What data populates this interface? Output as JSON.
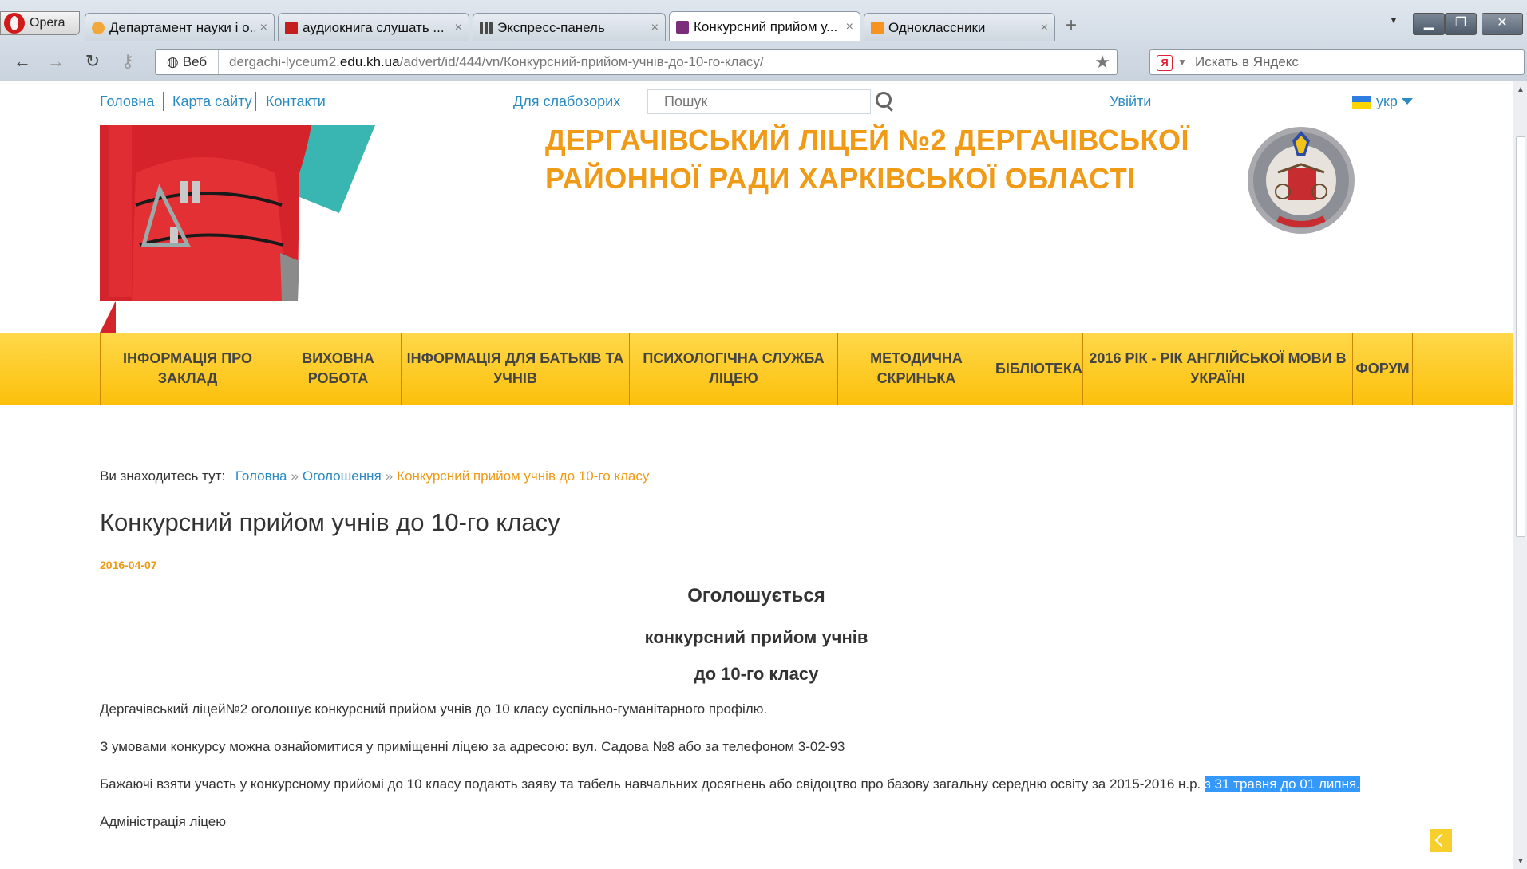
{
  "browser": {
    "opera_label": "Opera",
    "tabs": [
      {
        "title": "Департамент науки і о...",
        "close": "×",
        "icon_color": "#f2a83a"
      },
      {
        "title": "аудиокнига слушать ...",
        "close": "×",
        "icon_color": "#c41e1e"
      },
      {
        "title": "Экспресс-панель",
        "close": "×",
        "icon_color": "#4a4a4a"
      },
      {
        "title": "Конкурсний прийом у...",
        "close": "×",
        "icon_color": "#7a2e7a"
      },
      {
        "title": "Одноклассники",
        "close": "×",
        "icon_color": "#f7931e"
      }
    ],
    "address_mode": "Веб",
    "url_prefix": "dergachi-lyceum2.",
    "url_domain": "edu.kh.ua",
    "url_path": "/advert/id/444/vn/Конкурсний-прийом-учнів-до-10-го-класу/",
    "search_placeholder": "Искать в Яндекс",
    "yandex_letter": "Я"
  },
  "site": {
    "topnav": {
      "home": "Головна",
      "sitemap": "Карта сайту",
      "contacts": "Контакти",
      "low_vision": "Для слабозорих",
      "search_placeholder": "Пошук",
      "login": "Увійти",
      "lang": "укр"
    },
    "title_line1": "ДЕРГАЧІВСЬКИЙ ЛІЦЕЙ №2 ДЕРГАЧІВСЬКОЇ",
    "title_line2": "РАЙОННОЇ РАДИ ХАРКІВСЬКОЇ ОБЛАСТІ",
    "menu": [
      {
        "line1": "ІНФОРМАЦІЯ ПРО",
        "line2": "ЗАКЛАД"
      },
      {
        "line1": "ВИХОВНА",
        "line2": "РОБОТА"
      },
      {
        "line1": "ІНФОРМАЦІЯ ДЛЯ БАТЬКІВ ТА",
        "line2": "УЧНІВ"
      },
      {
        "line1": "ПСИХОЛОГІЧНА СЛУЖБА",
        "line2": "ЛІЦЕЮ"
      },
      {
        "line1": "МЕТОДИЧНА",
        "line2": "СКРИНЬКА"
      },
      {
        "line1": "БІБЛІОТЕКА",
        "line2": ""
      },
      {
        "line1": "2016 РІК - РІК АНГЛІЙСЬКОЇ МОВИ В",
        "line2": "УКРАЇНІ"
      },
      {
        "line1": "ФОРУМ",
        "line2": ""
      }
    ],
    "colors": {
      "accent_orange": "#f09a15",
      "link_blue": "#2c8ac2",
      "menu_yellow": "#fcc00b"
    }
  },
  "content": {
    "breadcrumb": {
      "prefix": "Ви знаходитесь тут:",
      "home": "Головна",
      "section": "Оголошення",
      "current": "Конкурсний прийом учнів до 10-го класу",
      "arrow": "»"
    },
    "title": "Конкурсний прийом учнів до 10-го класу",
    "date": "2016-04-07",
    "heading1": "Оголошується",
    "heading2": "конкурсний прийом учнів",
    "heading3": "до 10-го класу",
    "para1": "Дергачівський ліцей№2 оголошує конкурсний прийом учнів до 10 класу суспільно-гуманітарного профілю.",
    "para2": "З умовами конкурсу можна ознайомитися у приміщенні ліцею за адресою: вул. Садова №8 або за телефоном 3-02-93",
    "para3_main": "Бажаючі взяти участь у конкурсному прийомі до 10 класу подають заяву та табель навчальних досягнень або свідоцтво про базову загальну середню освіту за 2015-2016 н.р.",
    "para3_selected": "з 31 травня до 01 липня.",
    "para4": "Адміністрація ліцею"
  }
}
